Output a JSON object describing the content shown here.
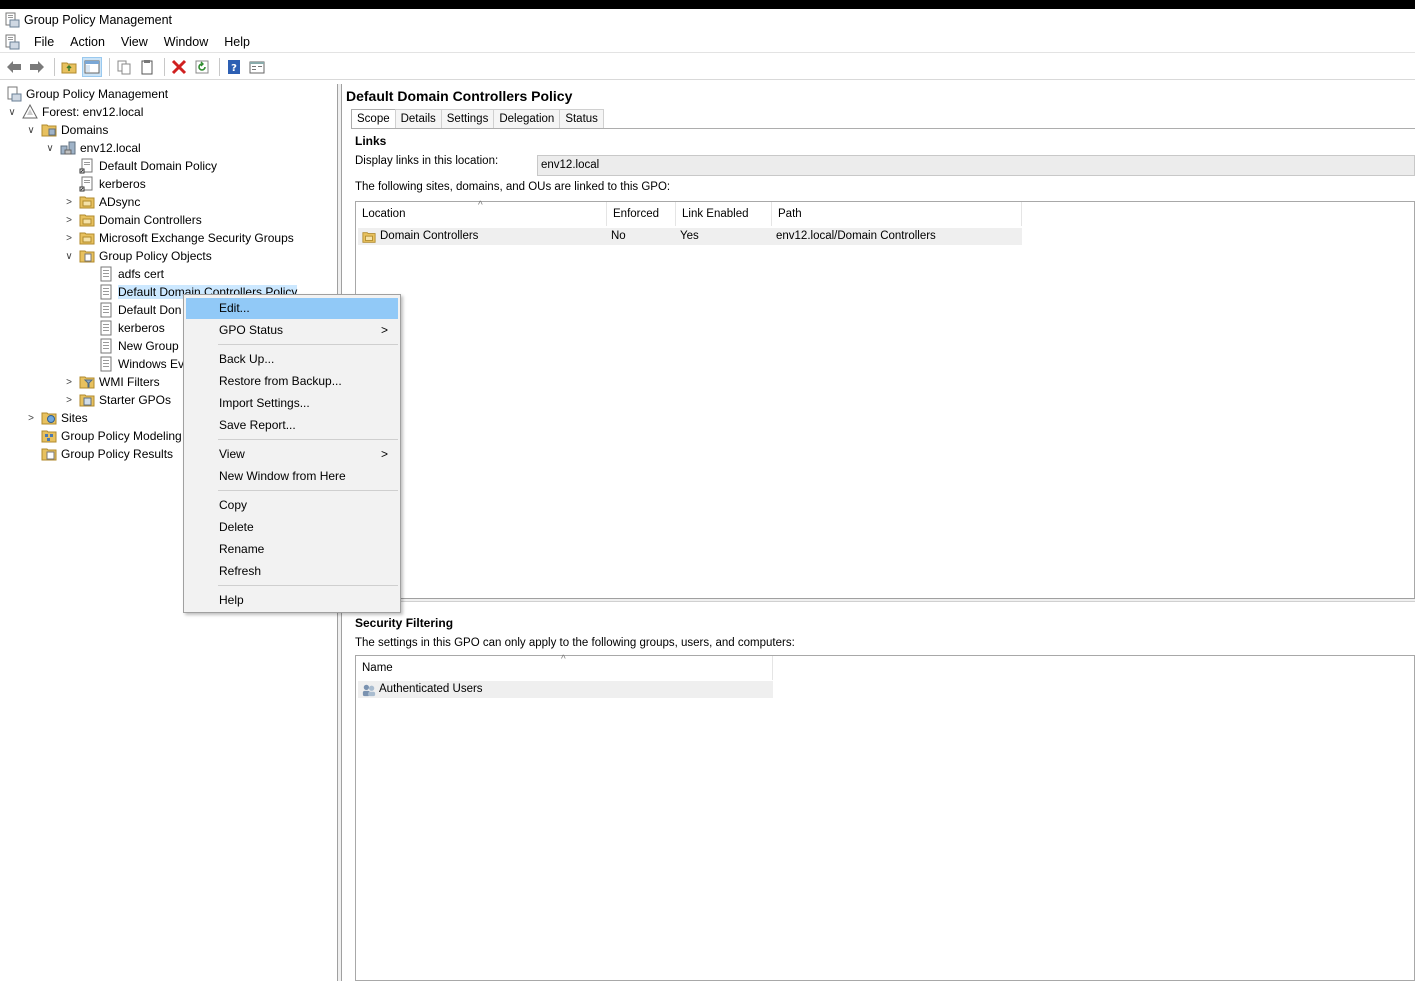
{
  "window": {
    "title": "Group Policy Management"
  },
  "menubar": {
    "items": [
      "File",
      "Action",
      "View",
      "Window",
      "Help"
    ]
  },
  "toolbar": {
    "buttons": [
      "back-arrow-icon",
      "forward-arrow-icon",
      "folder-up-icon",
      "show-hide-tree-icon",
      "copy-icon",
      "paste-icon",
      "delete-icon",
      "refresh-icon",
      "help-icon",
      "properties-icon"
    ]
  },
  "tree": {
    "root": "Group Policy Management",
    "forest": "Forest: env12.local",
    "domains": "Domains",
    "domain": "env12.local",
    "default_domain_policy": "Default Domain Policy",
    "kerberos_link": "kerberos",
    "adsync": "ADsync",
    "domain_controllers": "Domain Controllers",
    "exchange_groups": "Microsoft Exchange Security Groups",
    "gpo_container": "Group Policy Objects",
    "gpo_adfs": "adfs cert",
    "gpo_ddcp": "Default Domain Controllers Policy",
    "gpo_ddp": "Default Don",
    "gpo_kerberos": "kerberos",
    "gpo_new": "New Group",
    "gpo_windows": "Windows Ev",
    "wmi_filters": "WMI Filters",
    "starter_gpos": "Starter GPOs",
    "sites": "Sites",
    "modeling": "Group Policy Modeling",
    "results": "Group Policy Results"
  },
  "details": {
    "title": "Default Domain Controllers Policy",
    "tabs": [
      "Scope",
      "Details",
      "Settings",
      "Delegation",
      "Status"
    ],
    "links": {
      "heading": "Links",
      "display_label": "Display links in this location:",
      "display_value": "env12.local",
      "description": "The following sites, domains, and OUs are linked to this GPO:",
      "columns": [
        "Location",
        "Enforced",
        "Link Enabled",
        "Path"
      ],
      "rows": [
        {
          "location": "Domain Controllers",
          "enforced": "No",
          "link_enabled": "Yes",
          "path": "env12.local/Domain Controllers"
        }
      ]
    },
    "security": {
      "heading": "Security Filtering",
      "description": "The settings in this GPO can only apply to the following groups, users, and computers:",
      "columns": [
        "Name"
      ],
      "rows": [
        {
          "name": "Authenticated Users"
        }
      ]
    }
  },
  "context_menu": {
    "edit": "Edit...",
    "gpo_status": "GPO Status",
    "back_up": "Back Up...",
    "restore": "Restore from Backup...",
    "import": "Import Settings...",
    "save_report": "Save Report...",
    "view": "View",
    "new_window": "New Window from Here",
    "copy": "Copy",
    "delete": "Delete",
    "rename": "Rename",
    "refresh": "Refresh",
    "help": "Help"
  },
  "colors": {
    "menu_highlight": "#91c9f7",
    "selection": "#cce8ff",
    "folder": "#e8c15f"
  }
}
